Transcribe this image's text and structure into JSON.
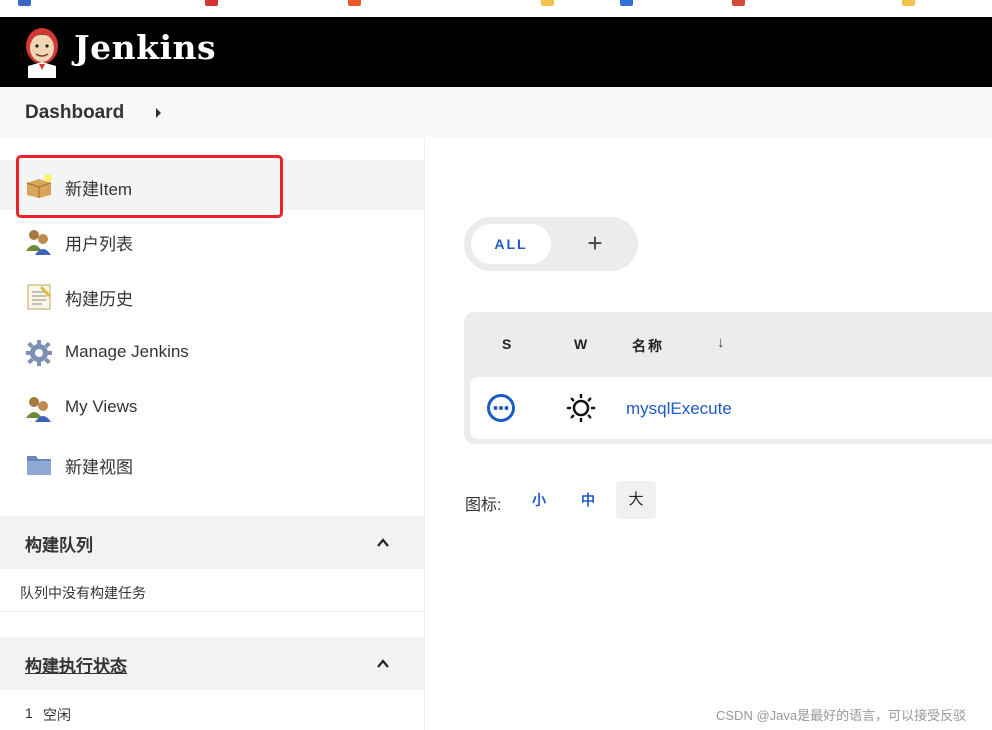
{
  "header": {
    "brand": "Jenkins"
  },
  "breadcrumb": {
    "item": "Dashboard"
  },
  "sidebar": {
    "tasks": [
      {
        "label": "新建Item",
        "icon": "new-item-package-icon"
      },
      {
        "label": "用户列表",
        "icon": "users-icon"
      },
      {
        "label": "构建历史",
        "icon": "notepad-icon"
      },
      {
        "label": "Manage Jenkins",
        "icon": "gear-icon"
      },
      {
        "label": "My Views",
        "icon": "users-icon"
      },
      {
        "label": "新建视图",
        "icon": "folder-icon"
      }
    ],
    "build_queue": {
      "title": "构建队列",
      "empty_text": "队列中没有构建任务"
    },
    "executor_status": {
      "title": "构建执行状态",
      "rows": [
        {
          "index": "1",
          "state": "空闲"
        }
      ]
    }
  },
  "main": {
    "tabs": {
      "all_label": "ALL",
      "add_label": "+"
    },
    "table": {
      "columns": {
        "status": "S",
        "weather": "W",
        "name": "名称",
        "sort": "↓"
      },
      "jobs": [
        {
          "name": "mysqlExecute",
          "status_icon": "not-built-icon",
          "weather_icon": "sun-weather-icon"
        }
      ]
    },
    "icon_size": {
      "label": "图标:",
      "small": "小",
      "medium": "中",
      "large": "大",
      "selected": "大"
    }
  },
  "colors": {
    "accent": "#1e5bc6",
    "highlight": "#f0202a",
    "header_bg": "#000000"
  },
  "watermark": "CSDN @Java是最好的语言，可以接受反驳"
}
